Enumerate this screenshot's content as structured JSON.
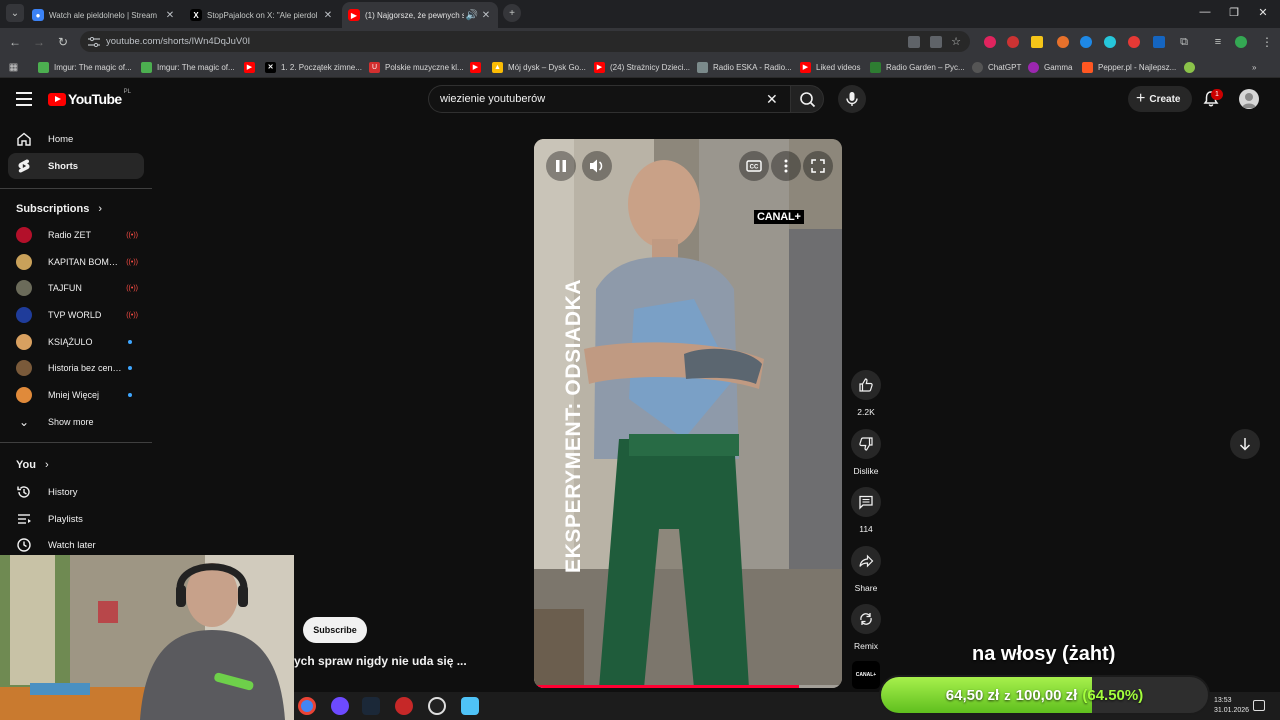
{
  "browser": {
    "tabs": [
      {
        "title": "Watch ale pieldolnelo | Stream",
        "active": false
      },
      {
        "title": "StopPajalock on X: \"Ale pierdol",
        "active": false
      },
      {
        "title": "(1) Najgorsze, że pewnych s",
        "active": true
      }
    ],
    "url": "youtube.com/shorts/IWn4DqJuV0I",
    "bookmarks": [
      {
        "label": "Imgur: The magic of..."
      },
      {
        "label": "Imgur: The magic of..."
      },
      {
        "label": ""
      },
      {
        "label": "1. 2. Początek zimne..."
      },
      {
        "label": "Polskie muzyczne kl..."
      },
      {
        "label": ""
      },
      {
        "label": "Mój dysk – Dysk Go..."
      },
      {
        "label": "(24) Strażnicy Dzieci..."
      },
      {
        "label": "Radio ESKA - Radio..."
      },
      {
        "label": "Liked videos"
      },
      {
        "label": "Radio Garden – Pyc..."
      },
      {
        "label": "ChatGPT"
      },
      {
        "label": "Gamma"
      },
      {
        "label": "Pepper.pl - Najlepsz..."
      }
    ]
  },
  "masthead": {
    "logo_text": "YouTube",
    "country_code": "PL",
    "search_value": "wiezienie youtuberów",
    "create_label": "Create",
    "notification_count": "1"
  },
  "sidebar": {
    "home": "Home",
    "shorts": "Shorts",
    "subscriptions_heading": "Subscriptions",
    "subscriptions": [
      {
        "name": "Radio ZET",
        "status": "live",
        "color": "#b3102a"
      },
      {
        "name": "KAPITAN BOMBA",
        "status": "live",
        "color": "#c9a15a"
      },
      {
        "name": "TAJFUN",
        "status": "live",
        "color": "#6b6b5a"
      },
      {
        "name": "TVP WORLD",
        "status": "live",
        "color": "#1f3c9a"
      },
      {
        "name": "KSIĄŻULO",
        "status": "new",
        "color": "#d8a060"
      },
      {
        "name": "Historia bez cenzury",
        "status": "new",
        "color": "#7a5a3a"
      },
      {
        "name": "Mniej Więcej",
        "status": "new",
        "color": "#e08a3a"
      }
    ],
    "show_more": "Show more",
    "you_heading": "You",
    "history": "History",
    "playlists": "Playlists",
    "watch_later": "Watch later"
  },
  "short": {
    "badge": "CANAL+",
    "overlay_text": "EKSPERYMENT: ODSIADKA",
    "progress": 0.86,
    "subscribe_label": "Subscribe",
    "title": "ych spraw nigdy nie uda się ..."
  },
  "actions": {
    "like_count": "2.2K",
    "dislike_label": "Dislike",
    "comment_count": "114",
    "share_label": "Share",
    "remix_label": "Remix",
    "channel_badge": "CANAL+"
  },
  "taskbar": {
    "time": "13:53",
    "date": "31.01.2026"
  },
  "stream_overlay": {
    "caption": "na włosy (żaht)",
    "donation_current": "64,50 zł",
    "donation_connector": "z",
    "donation_goal": "100,00 zł",
    "donation_percent_label": "(64.50%)",
    "donation_fraction": 0.645
  },
  "colors": {
    "accent_red": "#ff0000",
    "progress_red": "#ff0033",
    "donation_green": "#8ee63a",
    "background": "#0f0f0f"
  }
}
